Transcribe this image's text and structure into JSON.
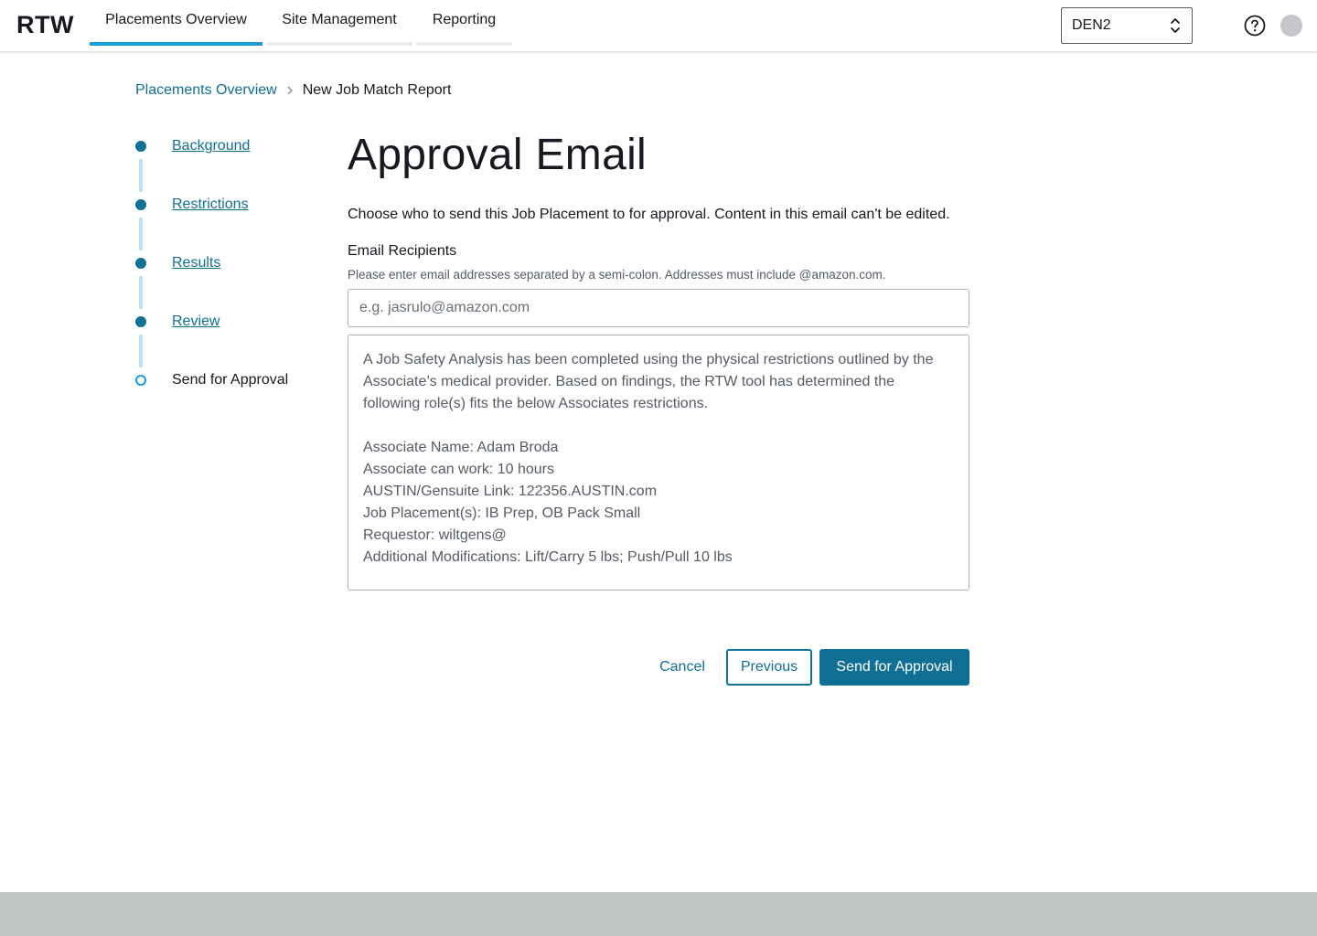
{
  "header": {
    "brand": "RTW",
    "tabs": [
      {
        "label": "Placements Overview",
        "active": true
      },
      {
        "label": "Site Management",
        "active": false
      },
      {
        "label": "Reporting",
        "active": false
      }
    ],
    "site_select": {
      "value": "DEN2",
      "icon": "chevron-up-down-icon"
    },
    "help_icon": "question-circle-icon",
    "avatar_icon": "user-avatar"
  },
  "breadcrumb": {
    "parent": "Placements Overview",
    "current": "New Job Match Report"
  },
  "steps": [
    {
      "label": "Background",
      "state": "complete"
    },
    {
      "label": "Restrictions",
      "state": "complete"
    },
    {
      "label": "Results",
      "state": "complete"
    },
    {
      "label": "Review",
      "state": "complete"
    },
    {
      "label": "Send for Approval",
      "state": "current"
    }
  ],
  "main": {
    "title": "Approval Email",
    "intro": "Choose who to send this Job Placement to for approval. Content in this email can't be edited.",
    "recipients_label": "Email Recipients",
    "recipients_hint": "Please enter email addresses separated by a semi-colon. Addresses must include @amazon.com.",
    "recipients_value": "",
    "recipients_placeholder": "e.g. jasrulo@amazon.com",
    "email_body": {
      "paragraph": "A Job Safety Analysis has been completed using the physical restrictions outlined by the Associate’s medical provider. Based on findings, the RTW tool has determined the following role(s) fits the below Associates restrictions.",
      "lines": [
        "Associate Name: Adam Broda",
        "Associate can work: 10 hours",
        "AUSTIN/Gensuite Link: 122356.AUSTIN.com",
        "Job Placement(s): IB Prep, OB Pack Small",
        "Requestor: wiltgens@",
        "Additional Modifications: Lift/Carry 5 lbs; Push/Pull 10 lbs"
      ]
    }
  },
  "actions": {
    "cancel": "Cancel",
    "previous": "Previous",
    "send": "Send for Approval"
  },
  "colors": {
    "primary": "#0f6f94",
    "active_tab_underline": "#1a9fd4",
    "step_connector": "#b9e3f3",
    "footer_band": "#bfc4c4"
  }
}
